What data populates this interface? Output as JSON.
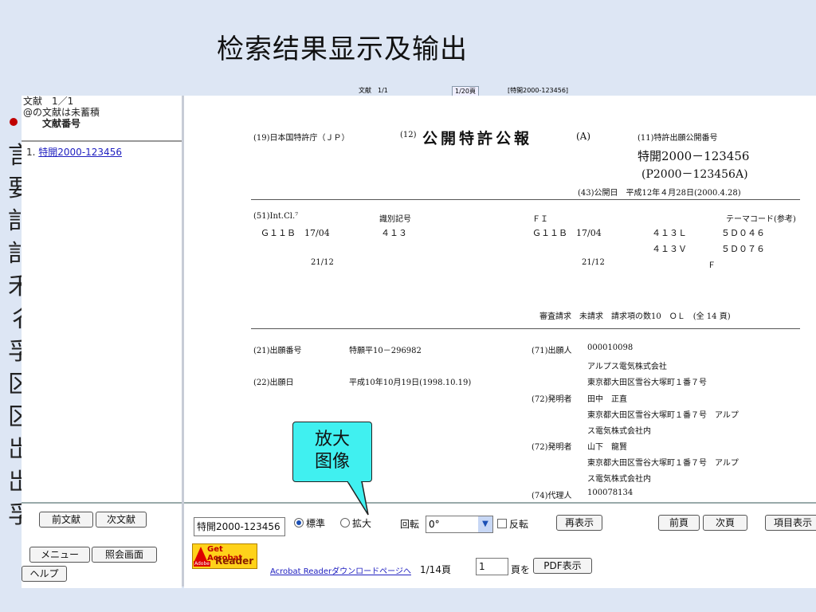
{
  "slide_title": "检索结果显示及输出",
  "left_glyphs": [
    "言",
    "要",
    "訁",
    "訁",
    "禾",
    "彳",
    "孚",
    "区",
    "区",
    "岀",
    "岀",
    "孚"
  ],
  "left_pane": {
    "count_line": "文献　1／1",
    "note_line": "@の文献は未蓄積",
    "col_header": "文献番号",
    "items": [
      {
        "index": "1.",
        "link": "特開2000-123456"
      }
    ]
  },
  "top_strip": {
    "text1": "文献　1/1",
    "text2": "1/20頁",
    "text3": "[特開2000-123456]"
  },
  "document": {
    "office": "(19)日本国特許庁（ＪＰ）",
    "kind_prefix": "(12)",
    "title": "公開特許公報",
    "kind": "(A)",
    "pubno_label": "(11)特許出願公開番号",
    "pubno": "特開2000－123456",
    "pubno_alt": "(P2000－123456A)",
    "pubdate": "(43)公開日　平成12年４月28日(2000.4.28)",
    "ipc_label": "(51)Int.Cl.⁷",
    "ident_label": "識別記号",
    "fi_label": "ＦＩ",
    "theme_label": "テーマコード(参考)",
    "row1": [
      "Ｇ１１Ｂ　17/04",
      "４１３",
      "Ｇ１１Ｂ　17/04",
      "４１３Ｌ",
      "５Ｄ０４６"
    ],
    "row2": [
      "４１３Ｖ",
      "５Ｄ０７６"
    ],
    "row3": [
      "21/12",
      "21/12",
      "Ｆ"
    ],
    "exam": "審査請求　未請求　請求項の数10　ＯＬ　(全 14 頁)",
    "appno_label": "(21)出願番号",
    "appno": "特願平10－296982",
    "appdate_label": "(22)出願日",
    "appdate": "平成10年10月19日(1998.10.19)",
    "applicant_label": "(71)出願人",
    "applicant_lines": [
      "000010098",
      "アルプス電気株式会社",
      "東京都大田区雪谷大塚町１番７号"
    ],
    "inventor1_label": "(72)発明者",
    "inventor1_lines": [
      "田中　正直",
      "東京都大田区雪谷大塚町１番７号　アルプ",
      "ス電気株式会社内"
    ],
    "inventor2_label": "(72)発明者",
    "inventor2_lines": [
      "山下　龍賢",
      "東京都大田区雪谷大塚町１番７号　アルプ",
      "ス電気株式会社内"
    ],
    "agent_label": "(74)代理人",
    "agent": "100078134"
  },
  "callout": {
    "line1": "放大",
    "line2": "图像"
  },
  "bottom_left": {
    "prev": "前文献",
    "next": "次文献",
    "menu": "メニュー",
    "query": "照会画面",
    "help": "ヘルプ"
  },
  "toolbar": {
    "doc_number": "特開2000-123456",
    "radio_standard": "標準",
    "radio_enlarge": "拡大",
    "rotate_label": "回転",
    "rotate_value": "0°",
    "reverse_label": "反転",
    "redisplay": "再表示",
    "prev_page": "前頁",
    "next_page": "次頁",
    "item_display": "項目表示",
    "acrobat_top": "Get Acrobat",
    "acrobat_bottom": "Reader",
    "acrobat_brand": "Adobe",
    "acrobat_link": "Acrobat Readerダウンロードページへ",
    "page_total": "1/14頁",
    "page_input": "1",
    "page_suffix": "頁を",
    "pdf_button": "PDF表示"
  }
}
